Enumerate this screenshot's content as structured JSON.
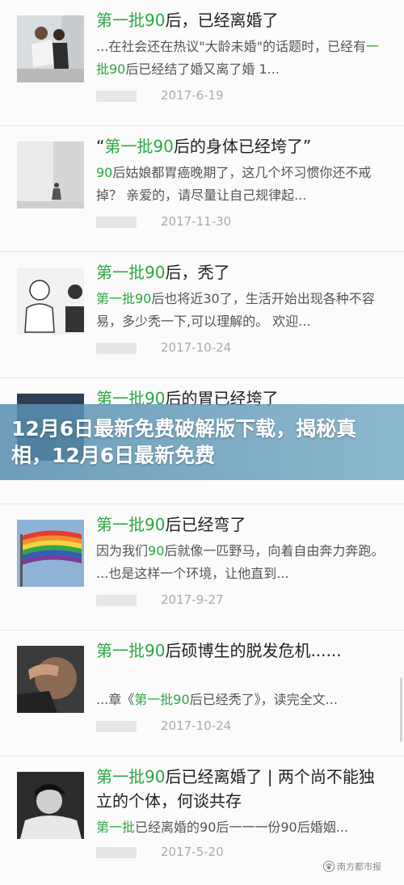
{
  "articles": [
    {
      "title_prefix": "",
      "title_highlight": "第一批90",
      "title_rest": "后，已经离婚了",
      "excerpt_a": "...在社会还在热议\"大龄未婚\"的话题时，已经有",
      "excerpt_hl": "一批90",
      "excerpt_b": "后已经结了婚又离了婚 1...",
      "date": "2017-6-19",
      "thumb_icon": "wedding-couple-photo"
    },
    {
      "title_prefix": "“",
      "title_highlight": "第一批90",
      "title_rest": "后的身体已经垮了”",
      "excerpt_a": "",
      "excerpt_hl": "90",
      "excerpt_b": "后姑娘都胃癌晚期了，这几个坏习惯你还不戒掉？ 亲爱的，请尽量让自己规律起...",
      "date": "2017-11-30",
      "thumb_icon": "person-wall-photo"
    },
    {
      "title_prefix": "",
      "title_highlight": "第一批90",
      "title_rest": "后，秃了",
      "excerpt_a": "",
      "excerpt_hl": "第一批90",
      "excerpt_b": "后也将近30了，生活开始出现各种不容易，多少秃一下,可以理解的。 欢迎...",
      "date": "2017-10-24",
      "thumb_icon": "cartoon-bald-photo"
    },
    {
      "title_prefix": "",
      "title_highlight": "第一批90",
      "title_rest": "后的胃已经垮了",
      "excerpt_a": "",
      "excerpt_hl": "",
      "excerpt_b": "",
      "date": "",
      "thumb_icon": "stomach-photo"
    },
    {
      "title_prefix": "",
      "title_highlight": "第一批90",
      "title_rest": "后已经弯了",
      "excerpt_a": "因为我们",
      "excerpt_hl": "90",
      "excerpt_b": "后就像一匹野马，向着自由奔力奔跑。 ...也是这样一个环境，让他直到...",
      "date": "2017-9-27",
      "thumb_icon": "rainbow-flag-photo"
    },
    {
      "title_prefix": "",
      "title_highlight": "第一批90",
      "title_rest": "后硕博生的脱发危机......",
      "excerpt_a": "...章《",
      "excerpt_hl": "第一批90",
      "excerpt_b": "后已经秃了》，读完全文...",
      "date": "2017-10-24",
      "thumb_icon": "hand-head-photo"
    },
    {
      "title_prefix": "",
      "title_highlight": "第一批90",
      "title_rest": "后已经离婚了 | 两个尚不能独立的个体，何谈共存",
      "excerpt_a": "",
      "excerpt_hl": "第一批",
      "excerpt_b": "已经离婚的90后一一一份90后婚姻...",
      "date": "2017-5-20",
      "thumb_icon": "sad-person-photo"
    }
  ],
  "overlay": {
    "title": "12月6日最新免费破解版下载，揭秘真相，12月6日最新免费"
  },
  "watermark": {
    "text": "南方都市报",
    "icon": "paw-icon"
  },
  "colors": {
    "highlight": "#2aa843",
    "date": "#aaaaaa",
    "overlay": "#5f95b6"
  }
}
